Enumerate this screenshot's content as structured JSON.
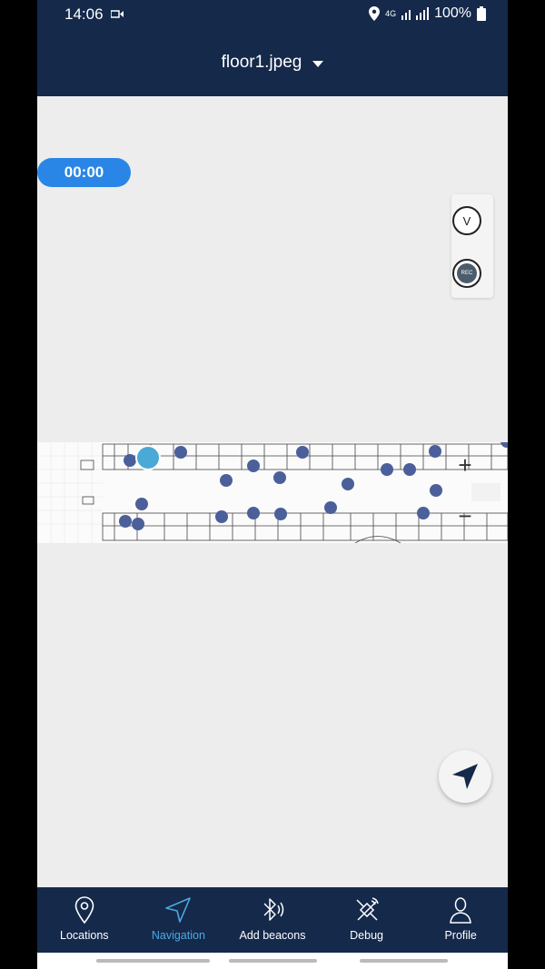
{
  "status": {
    "time": "14:06",
    "network": "4G",
    "battery": "100%"
  },
  "header": {
    "title": "floor1.jpeg"
  },
  "timer": "00:00",
  "controls": {
    "v_label": "V",
    "rec_label": "REC",
    "zoom_in": "+",
    "zoom_out": "−"
  },
  "nav": {
    "items": [
      {
        "label": "Locations",
        "icon": "location-pin-icon"
      },
      {
        "label": "Navigation",
        "icon": "navigation-arrow-icon",
        "active": true
      },
      {
        "label": "Add beacons",
        "icon": "bluetooth-beacon-icon"
      },
      {
        "label": "Debug",
        "icon": "debug-satellite-icon"
      },
      {
        "label": "Profile",
        "icon": "profile-icon"
      }
    ]
  },
  "colors": {
    "header": "#15294b",
    "accent": "#2a86e6",
    "beacon": "#4b5f9a",
    "current_position": "#4aa9d6"
  }
}
